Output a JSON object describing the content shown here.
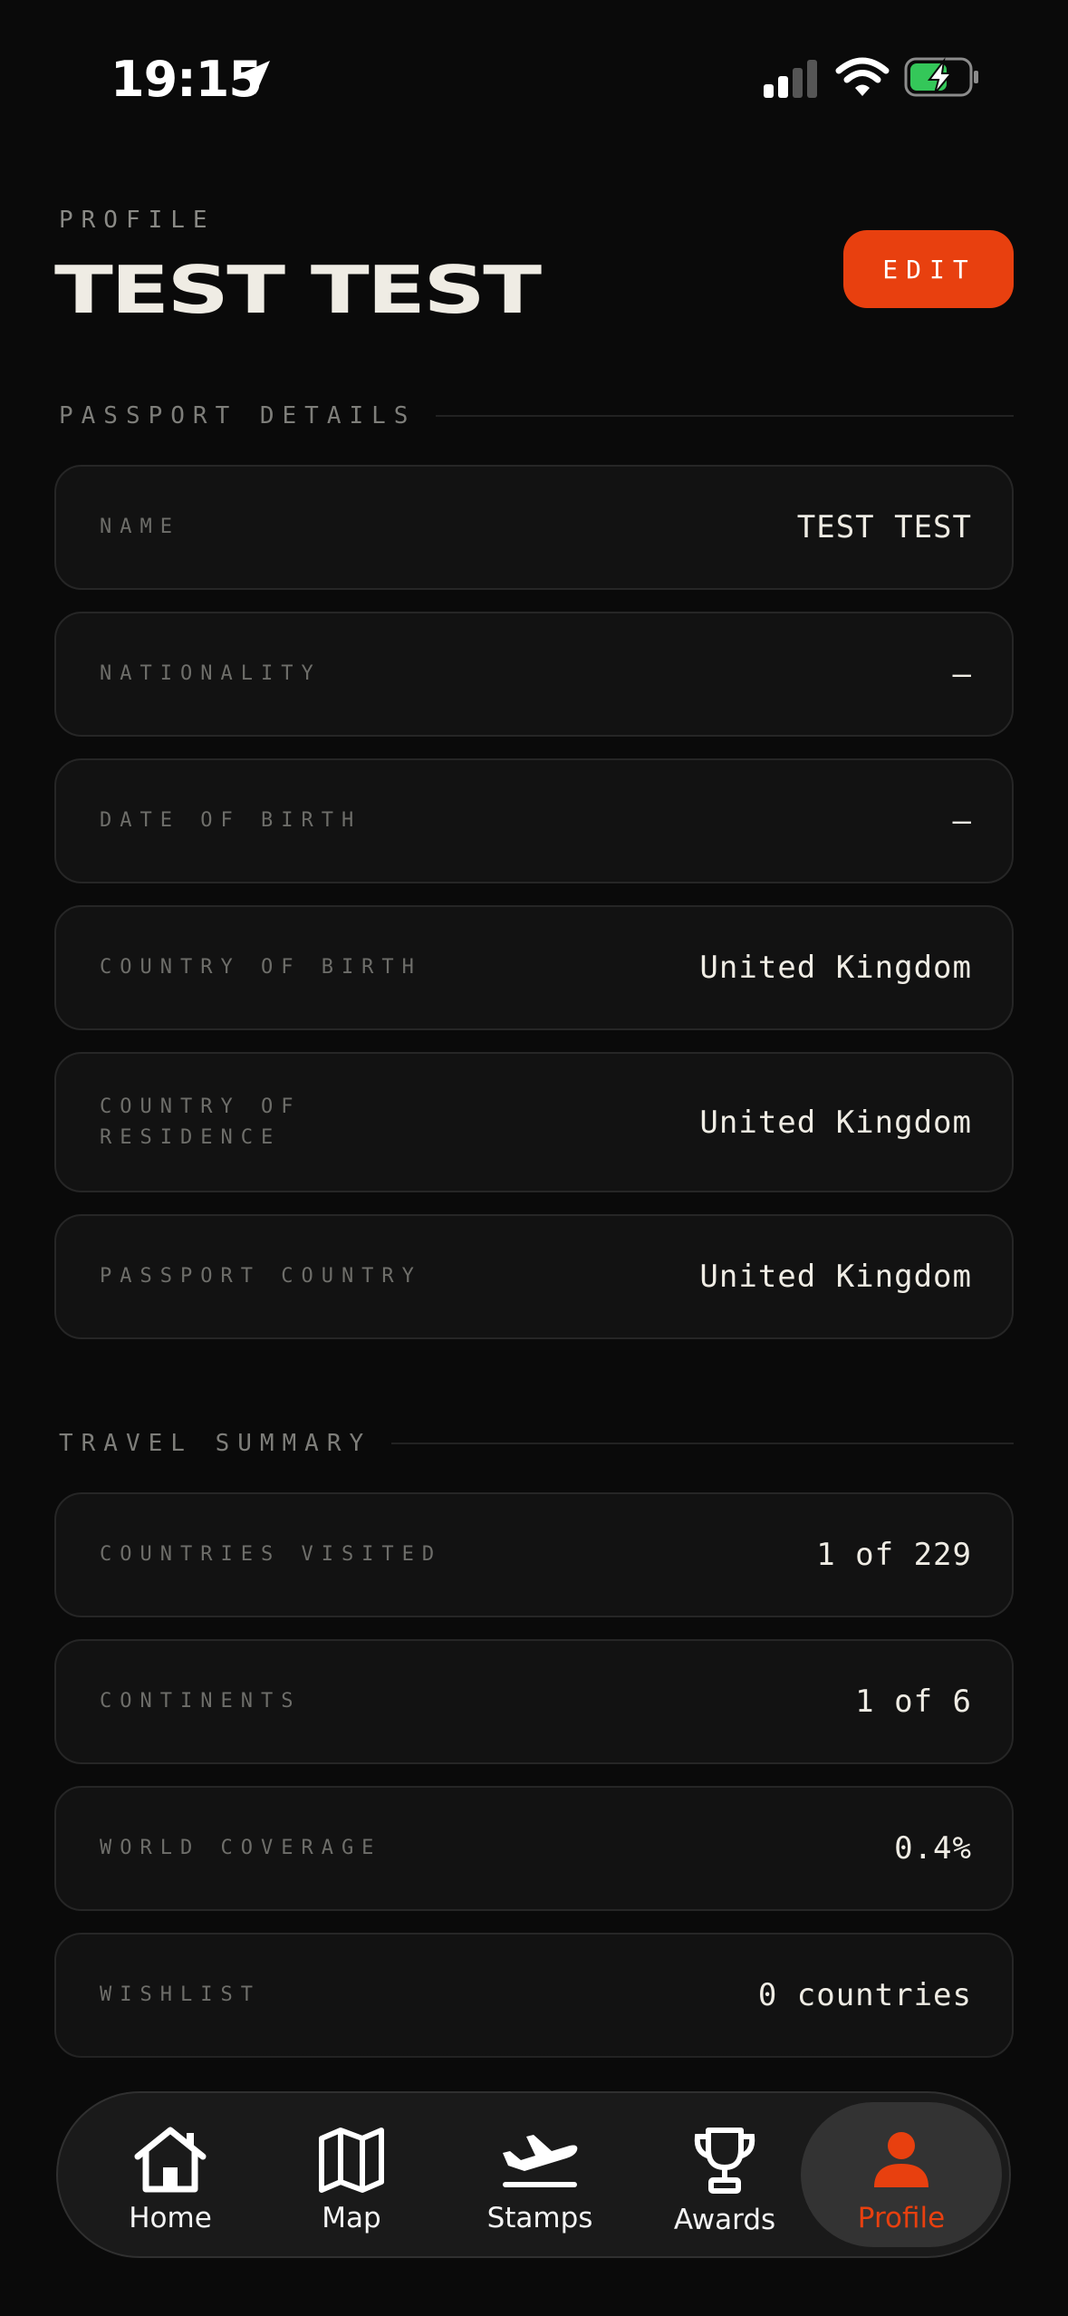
{
  "status_bar": {
    "time": "19:15"
  },
  "header": {
    "kicker": "PROFILE",
    "title": "TEST TEST",
    "edit_label": "EDIT"
  },
  "passport": {
    "heading": "PASSPORT DETAILS",
    "rows": [
      {
        "label": "NAME",
        "value": "TEST TEST"
      },
      {
        "label": "NATIONALITY",
        "value": "—"
      },
      {
        "label": "DATE OF BIRTH",
        "value": "—"
      },
      {
        "label": "COUNTRY OF BIRTH",
        "value": "United Kingdom"
      },
      {
        "label_line1": "COUNTRY OF",
        "label_line2": "RESIDENCE",
        "value": "United Kingdom"
      },
      {
        "label": "PASSPORT COUNTRY",
        "value": "United Kingdom"
      }
    ]
  },
  "travel": {
    "heading": "TRAVEL SUMMARY",
    "rows": [
      {
        "label": "COUNTRIES VISITED",
        "value": "1 of 229"
      },
      {
        "label": "CONTINENTS",
        "value": "1 of 6"
      },
      {
        "label": "WORLD COVERAGE",
        "value": "0.4%"
      },
      {
        "label": "WISHLIST",
        "value": "0 countries"
      }
    ]
  },
  "tabs": [
    {
      "label": "Home",
      "icon": "home-icon"
    },
    {
      "label": "Map",
      "icon": "map-icon"
    },
    {
      "label": "Stamps",
      "icon": "plane-icon"
    },
    {
      "label": "Awards",
      "icon": "trophy-icon"
    },
    {
      "label": "Profile",
      "icon": "person-icon",
      "active": true
    }
  ],
  "colors": {
    "accent": "#e8400f",
    "background": "#0a0a0a",
    "card": "#121212",
    "battery_charge": "#34c759"
  }
}
